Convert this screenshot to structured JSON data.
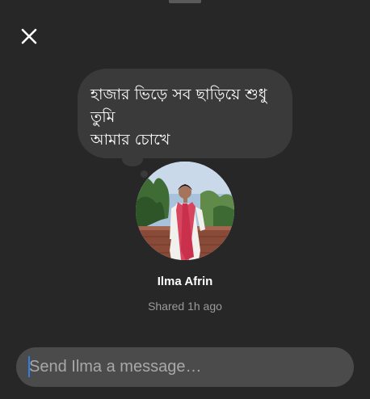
{
  "note": {
    "text_line1": "হাজার ভিড়ে সব ছাড়িয়ে শুধু তুমি",
    "text_line2": "আমার চোখে"
  },
  "profile": {
    "name": "Ilma Afrin",
    "shared_time": "Shared 1h ago"
  },
  "composer": {
    "placeholder": "Send Ilma a message…",
    "value": ""
  },
  "icons": {
    "close": "close-icon"
  },
  "colors": {
    "background": "#272727",
    "bubble": "#3a3a3a",
    "input_background": "#4b4b4b",
    "caret": "#2f7ee8",
    "secondary_text": "#9a9a9a"
  }
}
